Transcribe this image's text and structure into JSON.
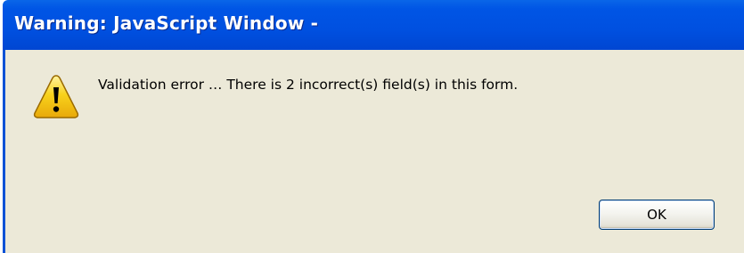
{
  "window": {
    "title": "Warning: JavaScript Window -"
  },
  "dialog": {
    "icon": "warning-icon",
    "message": "Validation error … There is 2 incorrect(s) field(s) in this form.",
    "ok_label": "OK"
  },
  "colors": {
    "title_bar": "#0055e5",
    "body_background": "#ece9d8",
    "icon_yellow": "#f8d21c",
    "button_border": "#003c74"
  }
}
